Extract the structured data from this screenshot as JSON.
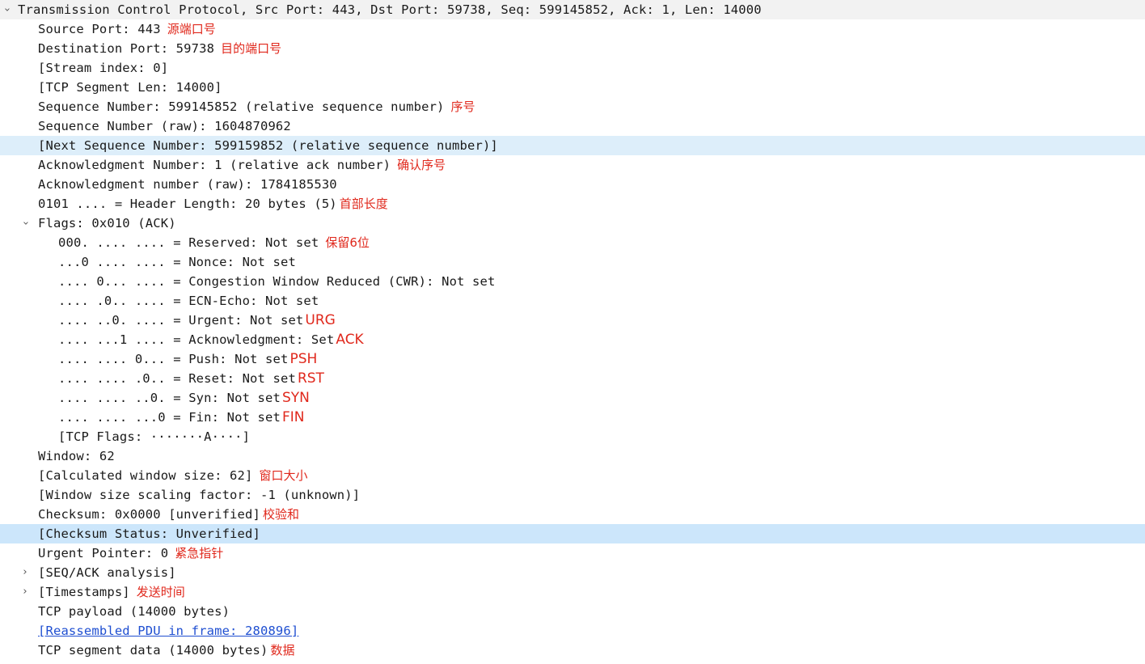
{
  "rows": [
    {
      "id": "tcp-header",
      "level": 0,
      "toggle": "expanded",
      "text": "Transmission Control Protocol, Src Port: 443, Dst Port: 59738, Seq: 599145852, Ack: 1, Len: 14000",
      "note": "",
      "style": "header"
    },
    {
      "id": "source-port",
      "level": 1,
      "text": "Source Port: 443",
      "note": "源端口号"
    },
    {
      "id": "destination-port",
      "level": 1,
      "text": "Destination Port: 59738",
      "note": "目的端口号"
    },
    {
      "id": "stream-index",
      "level": 1,
      "text": "[Stream index: 0]",
      "note": ""
    },
    {
      "id": "tcp-segment-len",
      "level": 1,
      "text": "[TCP Segment Len: 14000]",
      "note": ""
    },
    {
      "id": "sequence-number",
      "level": 1,
      "text": "Sequence Number: 599145852    (relative sequence number)",
      "note": "序号"
    },
    {
      "id": "sequence-number-raw",
      "level": 1,
      "text": "Sequence Number (raw): 1604870962",
      "note": ""
    },
    {
      "id": "next-sequence-number",
      "level": 1,
      "text": "[Next Sequence Number: 599159852    (relative sequence number)]",
      "note": "",
      "style": "hl-light"
    },
    {
      "id": "acknowledgment-number",
      "level": 1,
      "text": "Acknowledgment Number: 1    (relative ack number)",
      "note": "确认序号"
    },
    {
      "id": "acknowledgment-number-raw",
      "level": 1,
      "text": "Acknowledgment number (raw): 1784185530",
      "note": ""
    },
    {
      "id": "header-length",
      "level": 1,
      "text": "0101 .... = Header Length: 20 bytes (5)",
      "note": "首部长度",
      "note_tight": true
    },
    {
      "id": "flags",
      "level": 1,
      "toggle": "expanded",
      "text": "Flags: 0x010 (ACK)",
      "note": ""
    },
    {
      "id": "flag-reserved",
      "level": 2,
      "text": "000. .... .... = Reserved: Not set",
      "note": "保留6位"
    },
    {
      "id": "flag-nonce",
      "level": 2,
      "text": "...0 .... .... = Nonce: Not set",
      "note": ""
    },
    {
      "id": "flag-cwr",
      "level": 2,
      "text": ".... 0... .... = Congestion Window Reduced (CWR): Not set",
      "note": ""
    },
    {
      "id": "flag-ecn-echo",
      "level": 2,
      "text": ".... .0.. .... = ECN-Echo: Not set",
      "note": ""
    },
    {
      "id": "flag-urgent",
      "level": 2,
      "text": ".... ..0. .... = Urgent: Not set",
      "note": "URG",
      "note_big": true
    },
    {
      "id": "flag-acknowledgment",
      "level": 2,
      "text": ".... ...1 .... = Acknowledgment: Set",
      "note": "ACK",
      "note_big": true
    },
    {
      "id": "flag-push",
      "level": 2,
      "text": ".... .... 0... = Push: Not set",
      "note": "PSH",
      "note_big": true
    },
    {
      "id": "flag-reset",
      "level": 2,
      "text": ".... .... .0.. = Reset: Not set",
      "note": "RST",
      "note_big": true
    },
    {
      "id": "flag-syn",
      "level": 2,
      "text": ".... .... ..0. = Syn: Not set",
      "note": "SYN",
      "note_big": true
    },
    {
      "id": "flag-fin",
      "level": 2,
      "text": ".... .... ...0 = Fin: Not set",
      "note": "FIN",
      "note_big": true
    },
    {
      "id": "tcp-flags",
      "level": 2,
      "text": "[TCP Flags: ·······A····]",
      "note": ""
    },
    {
      "id": "window",
      "level": 1,
      "text": "Window: 62",
      "note": ""
    },
    {
      "id": "calculated-window-size",
      "level": 1,
      "text": "[Calculated window size: 62]",
      "note": "窗口大小"
    },
    {
      "id": "window-size-scaling-factor",
      "level": 1,
      "text": "[Window size scaling factor: -1 (unknown)]",
      "note": ""
    },
    {
      "id": "checksum",
      "level": 1,
      "text": "Checksum: 0x0000 [unverified]",
      "note": "校验和",
      "note_tight": true
    },
    {
      "id": "checksum-status",
      "level": 1,
      "text": "[Checksum Status: Unverified]",
      "note": "",
      "style": "hl"
    },
    {
      "id": "urgent-pointer",
      "level": 1,
      "text": "Urgent Pointer: 0",
      "note": "紧急指针"
    },
    {
      "id": "seq-ack-analysis",
      "level": 1,
      "toggle": "collapsed",
      "text": "[SEQ/ACK analysis]",
      "note": ""
    },
    {
      "id": "timestamps",
      "level": 1,
      "toggle": "collapsed",
      "text": "[Timestamps]",
      "note": "发送时间"
    },
    {
      "id": "tcp-payload",
      "level": 1,
      "text": "TCP payload (14000 bytes)",
      "note": ""
    },
    {
      "id": "reassembled-pdu",
      "level": 1,
      "text": "[Reassembled PDU in frame: 280896]",
      "note": "",
      "link": true
    },
    {
      "id": "tcp-segment-data",
      "level": 1,
      "text": "TCP segment data (14000 bytes)",
      "note": "数据",
      "note_tight": true
    }
  ],
  "icons": {
    "expanded": "chevron-down-icon",
    "collapsed": "chevron-right-icon"
  },
  "colors": {
    "annotation": "#e0281c",
    "selected_row": "#cce6fb",
    "hover_row": "#ddeefa",
    "header_row": "#f2f2f2",
    "link": "#1f4fd1"
  }
}
